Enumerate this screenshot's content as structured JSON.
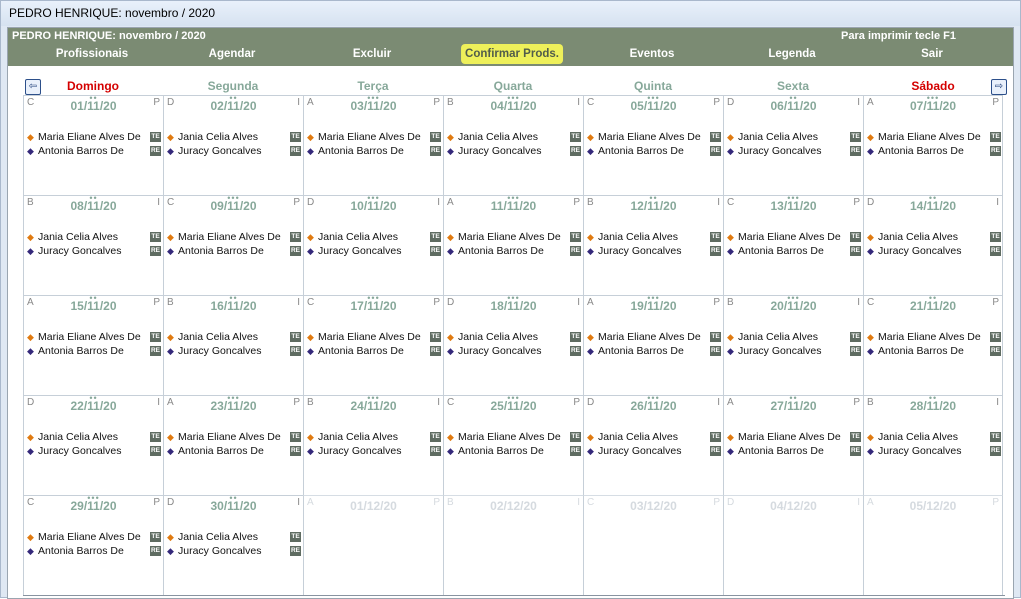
{
  "window": {
    "title": "PEDRO HENRIQUE: novembro / 2020"
  },
  "toolbar": {
    "title": "PEDRO HENRIQUE: novembro / 2020",
    "hint": "Para imprimir tecle F1",
    "items": [
      {
        "label": "Profissionais",
        "active": false
      },
      {
        "label": "Agendar",
        "active": false
      },
      {
        "label": "Excluir",
        "active": false
      },
      {
        "label": "Confirmar Prods.",
        "active": true
      },
      {
        "label": "Eventos",
        "active": false
      },
      {
        "label": "Legenda",
        "active": false
      },
      {
        "label": "Sair",
        "active": false
      }
    ]
  },
  "colors": {
    "toolbar": "#7b8b73",
    "highlight": "#eef05a",
    "weekday": "#87a89a",
    "weekend": "#d40000",
    "orange_marker": "#e07a10",
    "blue_marker": "#34287a"
  },
  "weekdays": [
    {
      "name": "Domingo",
      "weekend": true
    },
    {
      "name": "Segunda",
      "weekend": false
    },
    {
      "name": "Terça",
      "weekend": false
    },
    {
      "name": "Quarta",
      "weekend": false
    },
    {
      "name": "Quinta",
      "weekend": false
    },
    {
      "name": "Sexta",
      "weekend": false
    },
    {
      "name": "Sábado",
      "weekend": true
    }
  ],
  "entry_names": {
    "a": "Maria Eliane Alves De",
    "b": "Antonia Barros De",
    "c": "Jania Celia Alves",
    "d": "Juracy Goncalves"
  },
  "tags": {
    "te": "TE",
    "re": "RE"
  },
  "weeks": [
    [
      {
        "date": "01/11/20",
        "left": "C",
        "right": "P",
        "dots": "••",
        "pair": "ab"
      },
      {
        "date": "02/11/20",
        "left": "D",
        "right": "I",
        "dots": "••",
        "pair": "cd"
      },
      {
        "date": "03/11/20",
        "left": "A",
        "right": "P",
        "dots": "•••",
        "pair": "ab"
      },
      {
        "date": "04/11/20",
        "left": "B",
        "right": "I",
        "dots": "•••",
        "pair": "cd"
      },
      {
        "date": "05/11/20",
        "left": "C",
        "right": "P",
        "dots": "•••",
        "pair": "ab"
      },
      {
        "date": "06/11/20",
        "left": "D",
        "right": "I",
        "dots": "••",
        "pair": "cd"
      },
      {
        "date": "07/11/20",
        "left": "A",
        "right": "P",
        "dots": "•••",
        "pair": "ab"
      }
    ],
    [
      {
        "date": "08/11/20",
        "left": "B",
        "right": "I",
        "dots": "••",
        "pair": "cd"
      },
      {
        "date": "09/11/20",
        "left": "C",
        "right": "P",
        "dots": "•••",
        "pair": "ab"
      },
      {
        "date": "10/11/20",
        "left": "D",
        "right": "I",
        "dots": "•••",
        "pair": "cd"
      },
      {
        "date": "11/11/20",
        "left": "A",
        "right": "P",
        "dots": "•••",
        "pair": "ab"
      },
      {
        "date": "12/11/20",
        "left": "B",
        "right": "I",
        "dots": "••",
        "pair": "cd"
      },
      {
        "date": "13/11/20",
        "left": "C",
        "right": "P",
        "dots": "•••",
        "pair": "ab"
      },
      {
        "date": "14/11/20",
        "left": "D",
        "right": "I",
        "dots": "••",
        "pair": "cd"
      }
    ],
    [
      {
        "date": "15/11/20",
        "left": "A",
        "right": "P",
        "dots": "••",
        "pair": "ab"
      },
      {
        "date": "16/11/20",
        "left": "B",
        "right": "I",
        "dots": "••",
        "pair": "cd"
      },
      {
        "date": "17/11/20",
        "left": "C",
        "right": "P",
        "dots": "•••",
        "pair": "ab"
      },
      {
        "date": "18/11/20",
        "left": "D",
        "right": "I",
        "dots": "•••",
        "pair": "cd"
      },
      {
        "date": "19/11/20",
        "left": "A",
        "right": "P",
        "dots": "•••",
        "pair": "ab"
      },
      {
        "date": "20/11/20",
        "left": "B",
        "right": "I",
        "dots": "•••",
        "pair": "cd"
      },
      {
        "date": "21/11/20",
        "left": "C",
        "right": "P",
        "dots": "••",
        "pair": "ab"
      }
    ],
    [
      {
        "date": "22/11/20",
        "left": "D",
        "right": "I",
        "dots": "••",
        "pair": "cd"
      },
      {
        "date": "23/11/20",
        "left": "A",
        "right": "P",
        "dots": "•••",
        "pair": "ab"
      },
      {
        "date": "24/11/20",
        "left": "B",
        "right": "I",
        "dots": "•••",
        "pair": "cd"
      },
      {
        "date": "25/11/20",
        "left": "C",
        "right": "P",
        "dots": "•••",
        "pair": "ab"
      },
      {
        "date": "26/11/20",
        "left": "D",
        "right": "I",
        "dots": "•••",
        "pair": "cd"
      },
      {
        "date": "27/11/20",
        "left": "A",
        "right": "P",
        "dots": "••",
        "pair": "ab"
      },
      {
        "date": "28/11/20",
        "left": "B",
        "right": "I",
        "dots": "••",
        "pair": "cd"
      }
    ],
    [
      {
        "date": "29/11/20",
        "left": "C",
        "right": "P",
        "dots": "•••",
        "pair": "ab"
      },
      {
        "date": "30/11/20",
        "left": "D",
        "right": "I",
        "dots": "••",
        "pair": "cd"
      },
      {
        "date": "01/12/20",
        "left": "A",
        "right": "P",
        "dots": "",
        "pair": "",
        "faded": true
      },
      {
        "date": "02/12/20",
        "left": "B",
        "right": "I",
        "dots": "",
        "pair": "",
        "faded": true
      },
      {
        "date": "03/12/20",
        "left": "C",
        "right": "P",
        "dots": "",
        "pair": "",
        "faded": true
      },
      {
        "date": "04/12/20",
        "left": "D",
        "right": "I",
        "dots": "",
        "pair": "",
        "faded": true
      },
      {
        "date": "05/12/20",
        "left": "A",
        "right": "P",
        "dots": "",
        "pair": "",
        "faded": true
      }
    ]
  ]
}
